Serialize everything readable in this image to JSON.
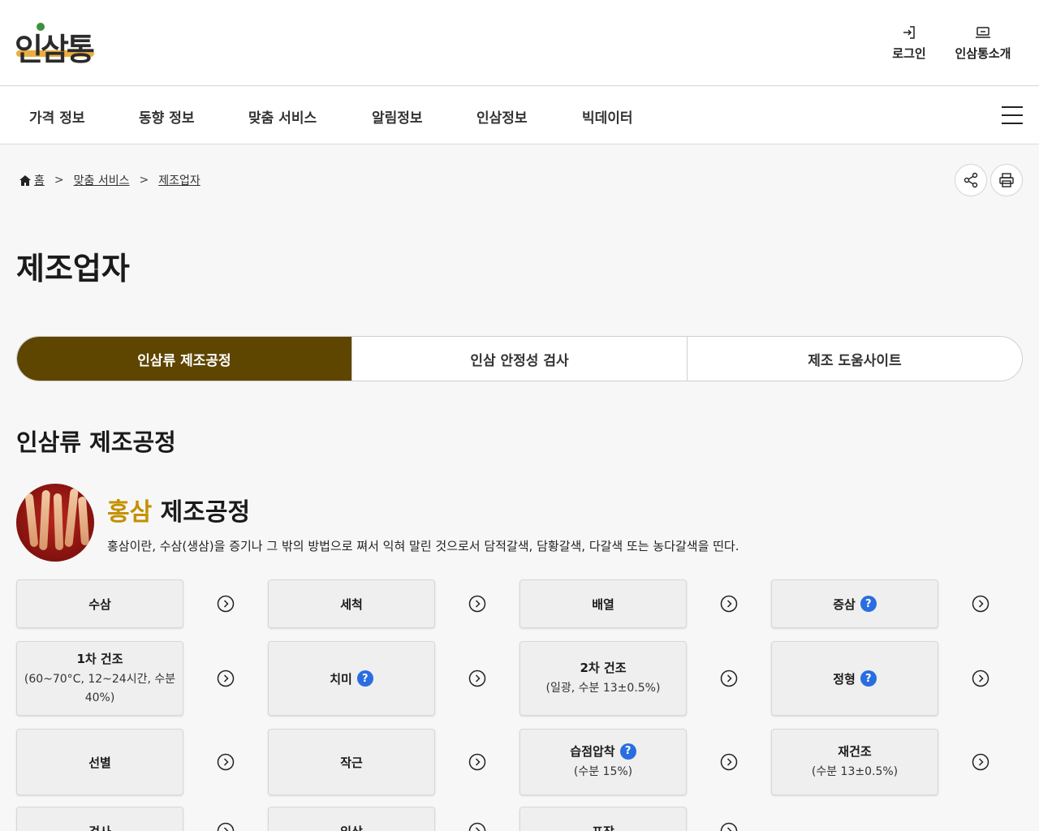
{
  "header": {
    "logo_text": "인삼통",
    "login_label": "로그인",
    "intro_label": "인삼통소개"
  },
  "nav": {
    "items": [
      "가격 정보",
      "동향 정보",
      "맞춤 서비스",
      "알림정보",
      "인삼정보",
      "빅데이터"
    ]
  },
  "breadcrumb": {
    "items": [
      "홈",
      "맞춤 서비스",
      "제조업자"
    ]
  },
  "page_title": "제조업자",
  "tabs": [
    {
      "label": "인삼류 제조공정",
      "active": true
    },
    {
      "label": "인삼 안정성 검사",
      "active": false
    },
    {
      "label": "제조 도움사이트",
      "active": false
    }
  ],
  "section_title": "인삼류 제조공정",
  "intro": {
    "title_accent": "홍삼",
    "title_rest": "제조공정",
    "description": "홍삼이란, 수삼(생삼)을 증기나 그 밖의 방법으로 쪄서 익혀 말린 것으로서 담적갈색, 담황갈색, 다갈색 또는 농다갈색을 띤다."
  },
  "steps": [
    {
      "name": "수삼",
      "sub": "",
      "help": false
    },
    {
      "name": "세척",
      "sub": "",
      "help": false
    },
    {
      "name": "배열",
      "sub": "",
      "help": false
    },
    {
      "name": "증삼",
      "sub": "",
      "help": true
    },
    {
      "name": "1차 건조",
      "sub": "(60~70°C, 12~24시간, 수분 40%)",
      "help": false
    },
    {
      "name": "치미",
      "sub": "",
      "help": true
    },
    {
      "name": "2차 건조",
      "sub": "(일광, 수분 13±0.5%)",
      "help": false
    },
    {
      "name": "정형",
      "sub": "",
      "help": true
    },
    {
      "name": "선별",
      "sub": "",
      "help": false
    },
    {
      "name": "작근",
      "sub": "",
      "help": false
    },
    {
      "name": "습점압착",
      "sub": "(수분 15%)",
      "help": true
    },
    {
      "name": "재건조",
      "sub": "(수분 13±0.5%)",
      "help": false
    },
    {
      "name": "검사",
      "sub": "",
      "help": false
    },
    {
      "name": "입상",
      "sub": "",
      "help": false
    },
    {
      "name": "포장",
      "sub": "",
      "help": false
    }
  ],
  "help_glyph": "?",
  "colors": {
    "active_tab": "#5e4500",
    "accent_text": "#c49000",
    "help_badge": "#2a6de0"
  }
}
